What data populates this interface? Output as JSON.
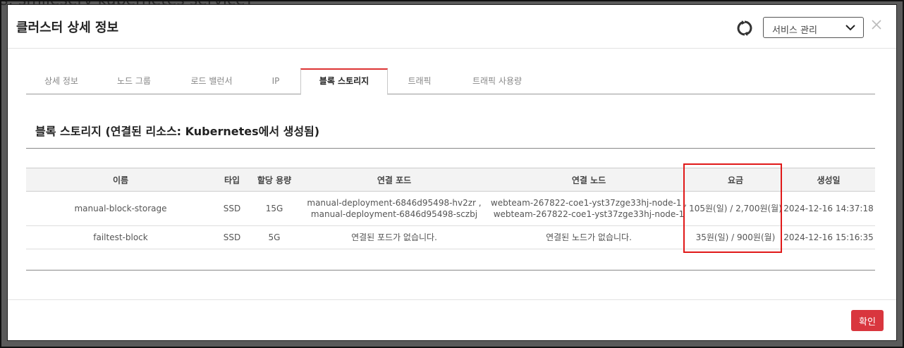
{
  "background": {
    "title": "s: smileserv kubernetes service]"
  },
  "modal": {
    "title": "클러스터 상세 정보",
    "service_select": {
      "value": "서비스 관리"
    },
    "tabs": [
      {
        "label": "상세 정보",
        "active": false
      },
      {
        "label": "노드 그룹",
        "active": false
      },
      {
        "label": "로드 밸런서",
        "active": false
      },
      {
        "label": "IP",
        "active": false
      },
      {
        "label": "블록 스토리지",
        "active": true
      },
      {
        "label": "트래픽",
        "active": false
      },
      {
        "label": "트래픽 사용량",
        "active": false
      }
    ],
    "section_title": "블록 스토리지 (연결된 리소스: Kubernetes에서 생성됨)",
    "table": {
      "columns": [
        "이름",
        "타입",
        "할당 용량",
        "연결 포드",
        "연결 노드",
        "요금",
        "생성일"
      ],
      "rows": [
        {
          "name": "manual-block-storage",
          "type": "SSD",
          "capacity": "15G",
          "pods": [
            "manual-deployment-6846d95498-hv2zr ,",
            "manual-deployment-6846d95498-sczbj"
          ],
          "nodes": [
            "webteam-267822-coe1-yst37zge33hj-node-1 ,",
            "webteam-267822-coe1-yst37zge33hj-node-1"
          ],
          "fee": "105원(일) / 2,700원(월)",
          "created": "2024-12-16 14:37:18"
        },
        {
          "name": "failtest-block",
          "type": "SSD",
          "capacity": "5G",
          "pods": [
            "연결된 포드가 없습니다."
          ],
          "nodes": [
            "연결된 노드가 없습니다."
          ],
          "fee": "35원(일) / 900원(월)",
          "created": "2024-12-16 15:16:35"
        }
      ]
    },
    "confirm_label": "확인"
  },
  "colors": {
    "accent": "#d9363e",
    "highlight": "#e01818",
    "active_tab_border": "#dd3333"
  },
  "icons": {
    "refresh": "refresh-icon",
    "close": "close-icon",
    "dropdown": "chevron-down-icon"
  }
}
